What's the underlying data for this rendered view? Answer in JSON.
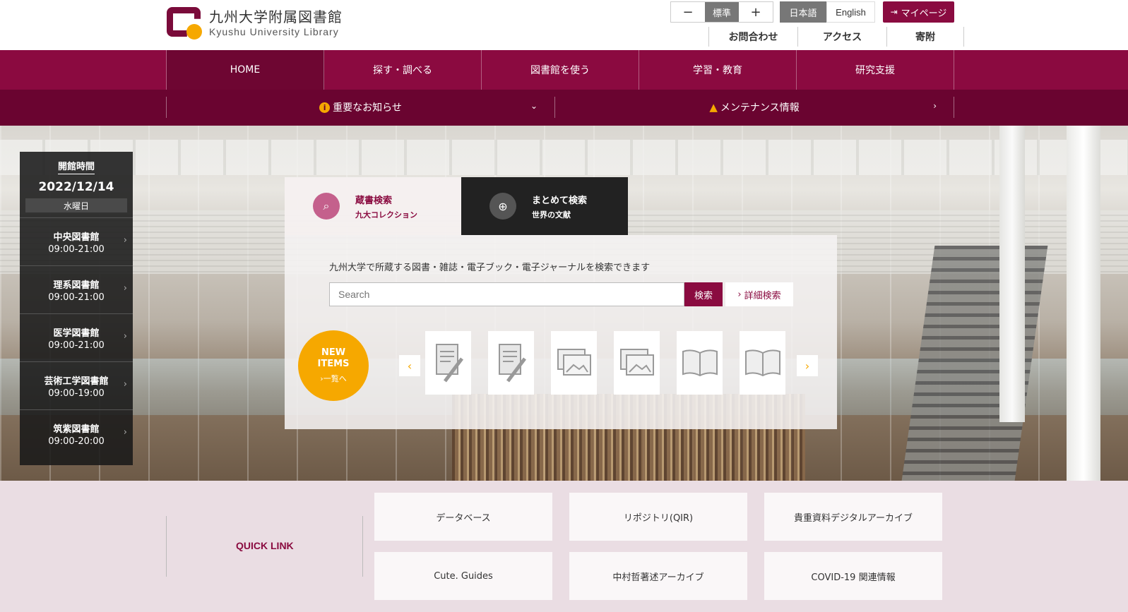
{
  "logo": {
    "title_jp": "九州大学附属図書館",
    "title_en": "Kyushu University Library"
  },
  "fontsize": {
    "decrease": "−",
    "standard": "標準",
    "increase": "+"
  },
  "language": {
    "japanese": "日本語",
    "english": "English"
  },
  "mypage": {
    "icon": "login-icon",
    "label": "マイページ"
  },
  "sublinks": [
    "お問合わせ",
    "アクセス",
    "寄附"
  ],
  "mainnav": [
    "HOME",
    "探す・調べる",
    "図書館を使う",
    "学習・教育",
    "研究支援"
  ],
  "notices": {
    "important": "重要なお知らせ",
    "maintenance": "メンテナンス情報",
    "colors": {
      "accent": "#f6a800",
      "brand": "#8a0b40"
    }
  },
  "hours": {
    "title": "開館時間",
    "date": "2022/12/14",
    "weekday": "水曜日",
    "libraries": [
      {
        "name": "中央図書館",
        "time": "09:00-21:00"
      },
      {
        "name": "理系図書館",
        "time": "09:00-21:00"
      },
      {
        "name": "医学図書館",
        "time": "09:00-21:00"
      },
      {
        "name": "芸術工学図書館",
        "time": "09:00-19:00"
      },
      {
        "name": "筑紫図書館",
        "time": "09:00-20:00"
      }
    ]
  },
  "search": {
    "tabs": [
      {
        "main": "蔵書検索",
        "sub": "九大コレクション",
        "icon": "catalog-search-icon"
      },
      {
        "main": "まとめて検索",
        "sub": "世界の文献",
        "icon": "globe-search-icon"
      }
    ],
    "description": "九州大学で所蔵する図書・雑誌・電子ブック・電子ジャーナルを検索できます",
    "placeholder": "Search",
    "button": "検索",
    "advanced": "詳細検索"
  },
  "new_items": {
    "line1": "NEW",
    "line2": "ITEMS",
    "link": "一覧へ",
    "thumbnails": [
      "manuscript-icon",
      "manuscript-icon",
      "image-icon",
      "image-icon",
      "book-icon",
      "book-icon"
    ]
  },
  "quicklink": {
    "title": "QUICK LINK",
    "items": [
      "データベース",
      "リポジトリ(QIR)",
      "貴重資料デジタルアーカイブ",
      "Cute. Guides",
      "中村哲著述アーカイブ",
      "COVID-19 関連情報"
    ]
  }
}
